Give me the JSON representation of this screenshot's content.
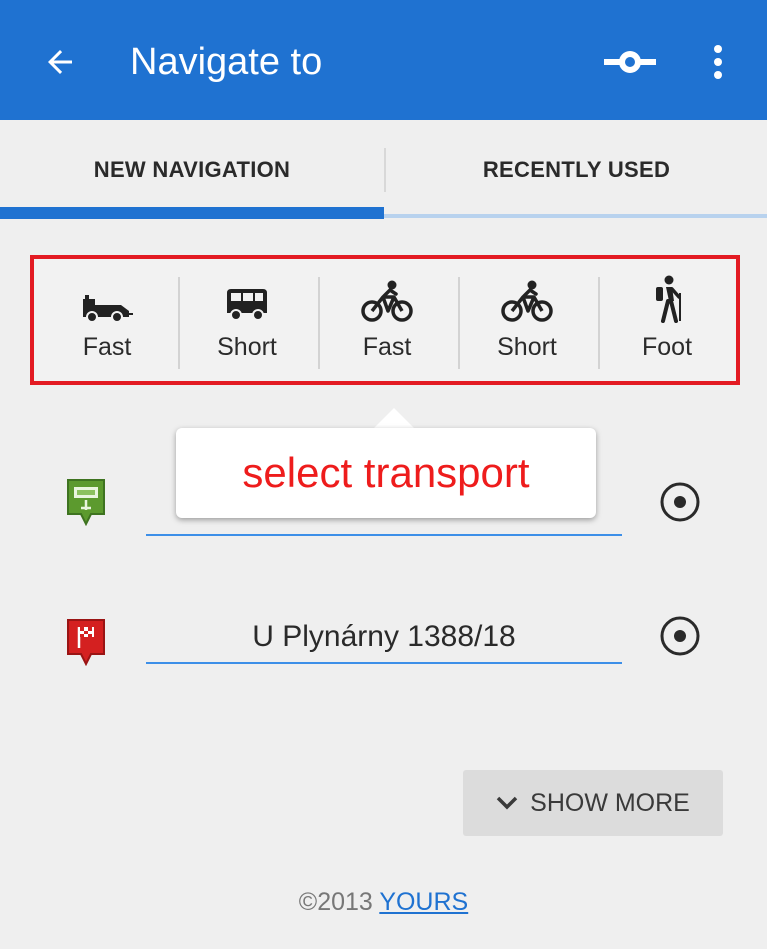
{
  "appbar": {
    "title": "Navigate to",
    "back_icon": "arrow-back-icon",
    "route_icon": "route-point-icon",
    "menu_icon": "more-vert-icon",
    "color": "#1f72d1"
  },
  "tabs": [
    {
      "label": "NEW NAVIGATION",
      "selected": true
    },
    {
      "label": "RECENTLY USED",
      "selected": false
    }
  ],
  "transport": {
    "highlight_color": "#e31b23",
    "modes": [
      {
        "icon": "car-icon",
        "label": "Fast"
      },
      {
        "icon": "van-icon",
        "label": "Short"
      },
      {
        "icon": "bicycle-icon",
        "label": "Fast"
      },
      {
        "icon": "bicycle-icon",
        "label": "Short"
      },
      {
        "icon": "hiker-icon",
        "label": "Foot"
      }
    ]
  },
  "tooltip": {
    "text": "select transport",
    "color": "#ee1c1c"
  },
  "route": {
    "start": {
      "value": "",
      "marker_icon": "start-flag-icon"
    },
    "end": {
      "value": "U Plynárny 1388/18",
      "marker_icon": "finish-flag-icon"
    },
    "locate_icon": "my-location-icon"
  },
  "show_more": {
    "label": "SHOW MORE",
    "icon": "chevron-down-icon"
  },
  "footer": {
    "prefix": "©2013 ",
    "link": "YOURS"
  }
}
